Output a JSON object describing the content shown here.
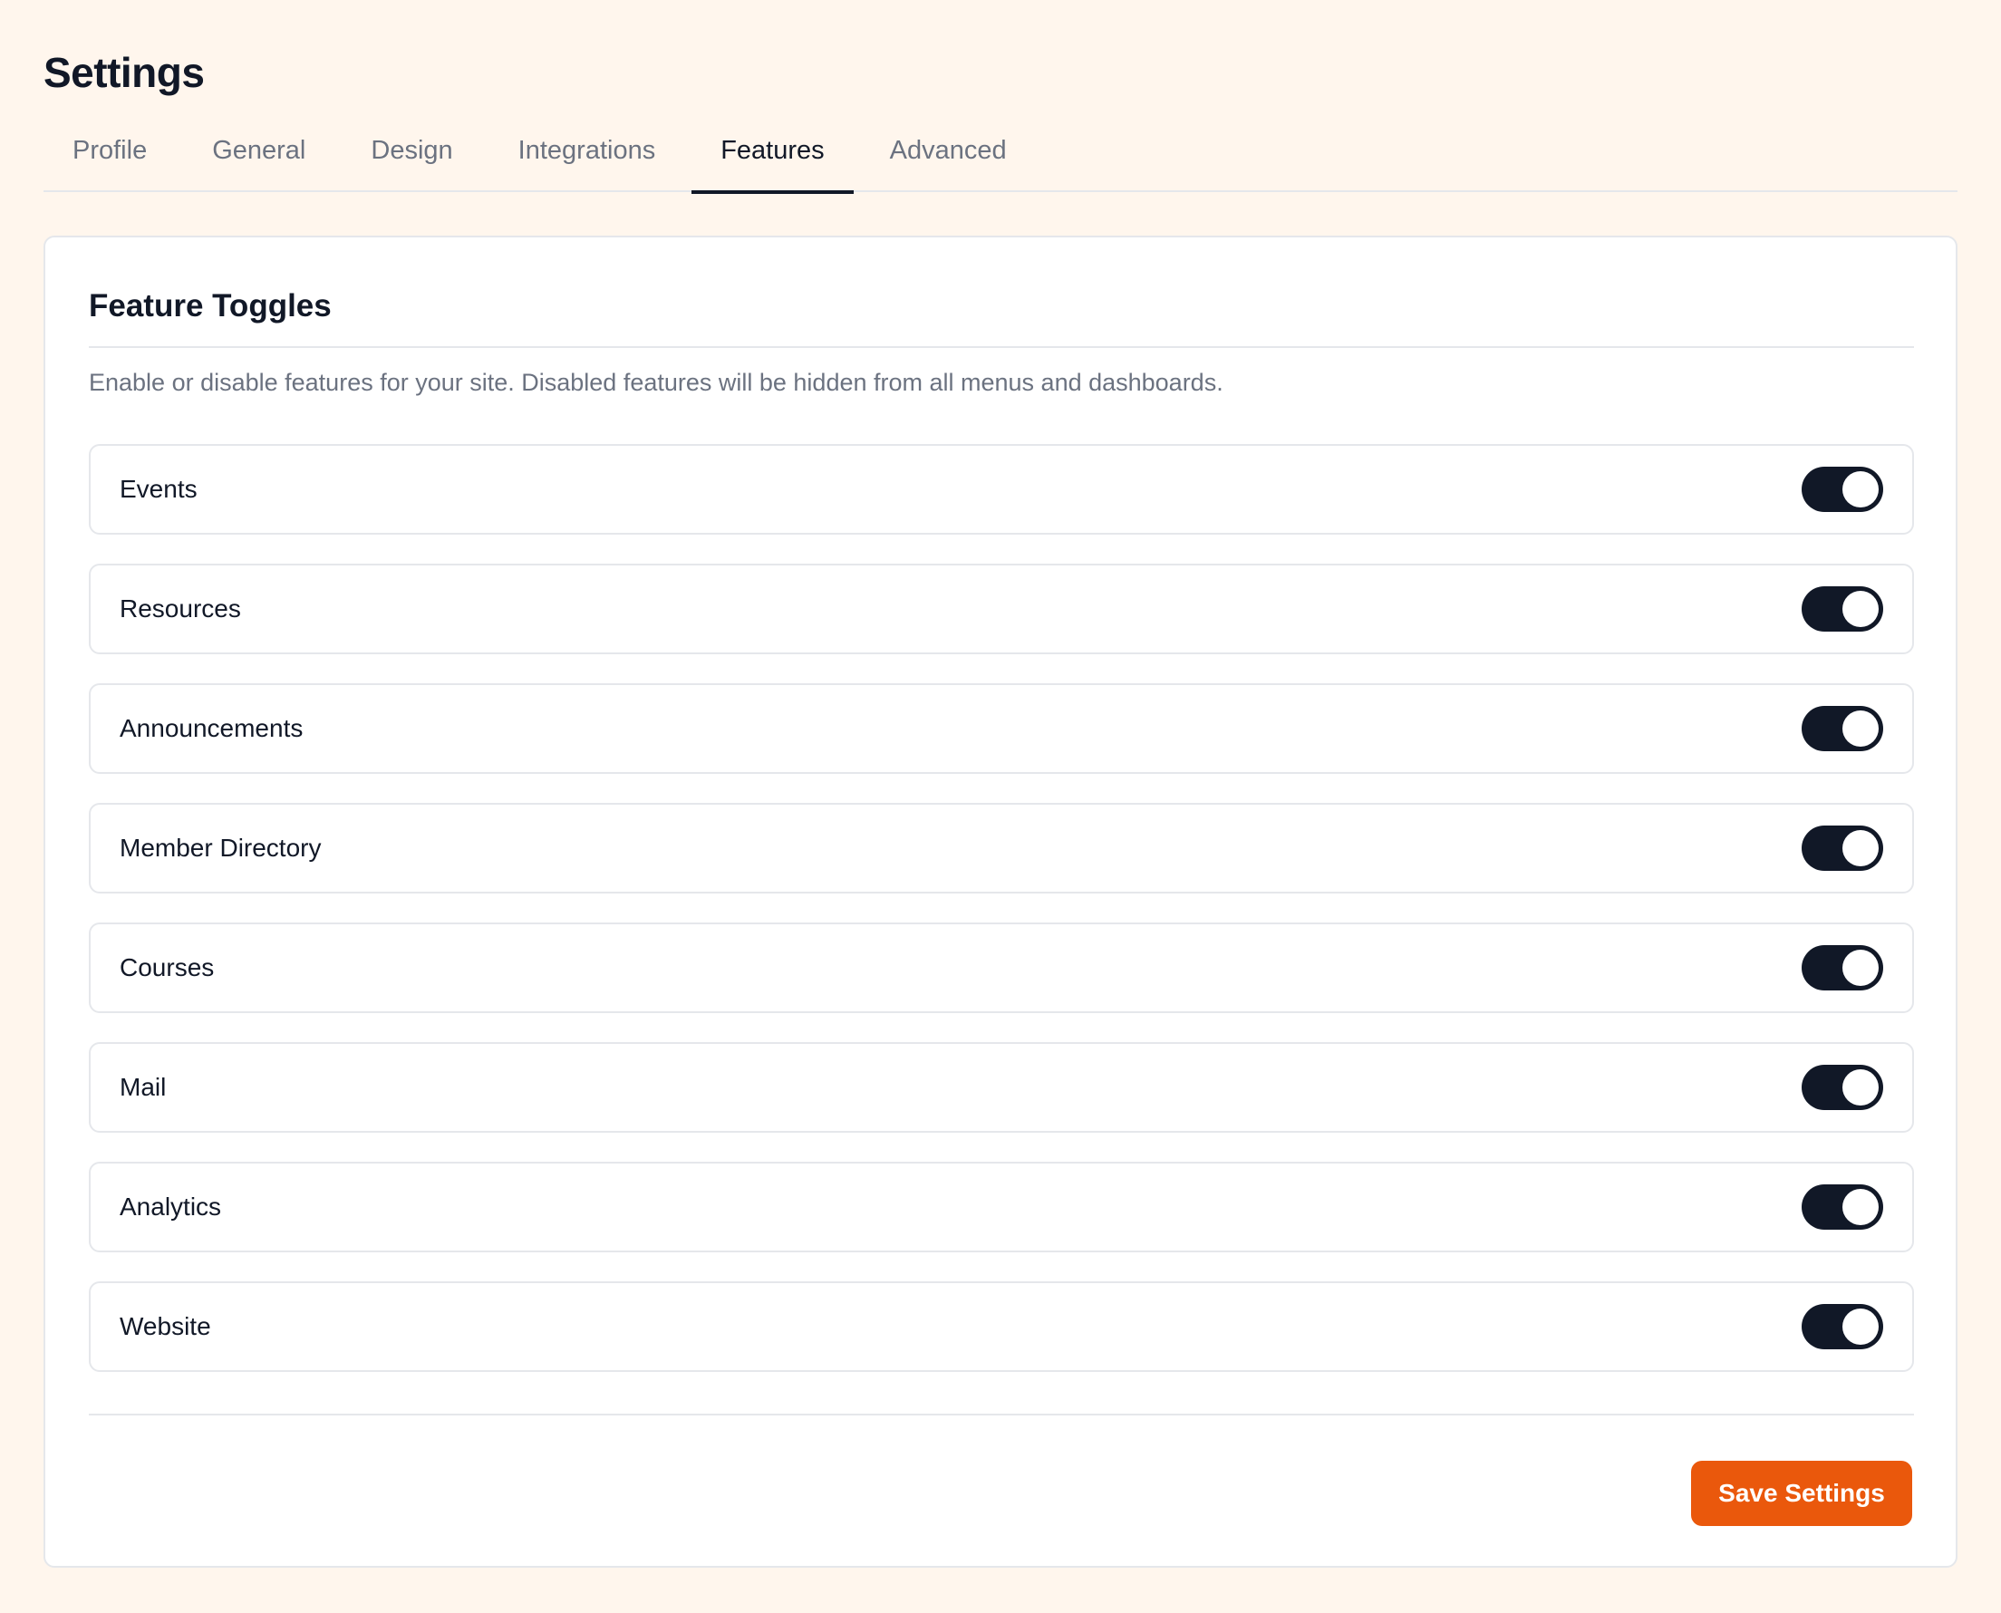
{
  "page": {
    "title": "Settings"
  },
  "tabs": [
    {
      "label": "Profile",
      "active": false
    },
    {
      "label": "General",
      "active": false
    },
    {
      "label": "Design",
      "active": false
    },
    {
      "label": "Integrations",
      "active": false
    },
    {
      "label": "Features",
      "active": true
    },
    {
      "label": "Advanced",
      "active": false
    }
  ],
  "card": {
    "title": "Feature Toggles",
    "description": "Enable or disable features for your site. Disabled features will be hidden from all menus and dashboards."
  },
  "features": [
    {
      "label": "Events",
      "enabled": true
    },
    {
      "label": "Resources",
      "enabled": true
    },
    {
      "label": "Announcements",
      "enabled": true
    },
    {
      "label": "Member Directory",
      "enabled": true
    },
    {
      "label": "Courses",
      "enabled": true
    },
    {
      "label": "Mail",
      "enabled": true
    },
    {
      "label": "Analytics",
      "enabled": true
    },
    {
      "label": "Website",
      "enabled": true
    }
  ],
  "actions": {
    "save_label": "Save Settings"
  },
  "colors": {
    "background": "#fff6ed",
    "toggle_on": "#111827",
    "accent": "#ea580c"
  }
}
